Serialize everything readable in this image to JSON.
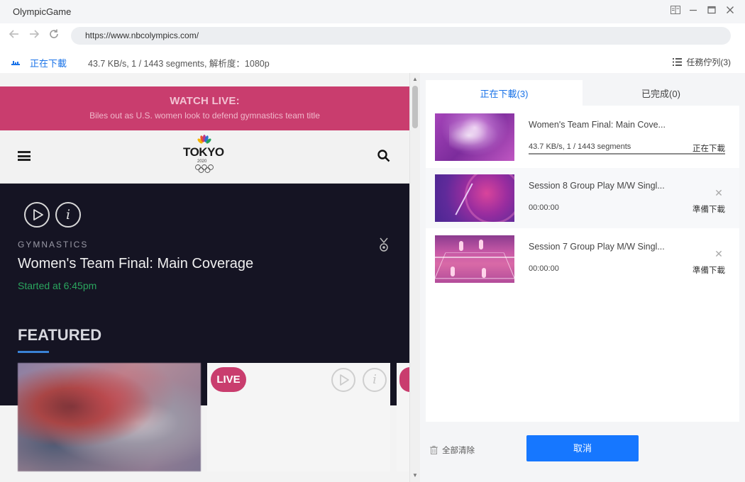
{
  "window": {
    "title": "OlympicGame",
    "controls": [
      "reader-icon",
      "minimize-icon",
      "maximize-icon",
      "close-icon"
    ]
  },
  "browser": {
    "url": "https://www.nbcolympics.com/"
  },
  "status": {
    "label": "正在下載",
    "info": "43.7 KB/s, 1 / 1443 segments, 解析度：1080p",
    "queue_label": "任務佇列(3)"
  },
  "website": {
    "banner_title": "WATCH LIVE:",
    "banner_subtitle": "Biles out as U.S. women look to defend gymnastics team title",
    "logo_text": "TOKYO",
    "logo_year": "2020",
    "hero": {
      "sport": "GYMNASTICS",
      "title": "Women's Team Final: Main Coverage",
      "time": "Started at 6:45pm"
    },
    "featured_label": "FEATURED",
    "live_badge": "LIVE",
    "info_glyph": "i",
    "colors": {
      "banner": "#c93d6e",
      "hero_bg": "#151423",
      "live_green": "#2aa55e"
    }
  },
  "panel": {
    "tabs": [
      {
        "label": "正在下載(3)",
        "active": true
      },
      {
        "label": "已完成(0)",
        "active": false
      }
    ],
    "tasks": [
      {
        "title": "Women's Team Final: Main Cove...",
        "info": "43.7 KB/s, 1 / 1443 segments",
        "status": "正在下載",
        "progress": 1.0
      },
      {
        "title": "Session 8 Group Play M/W Singl...",
        "info": "00:00:00",
        "status": "準備下載"
      },
      {
        "title": "Session 7 Group Play M/W Singl...",
        "info": "00:00:00",
        "status": "準備下載"
      }
    ],
    "clear_all": "全部清除",
    "cancel": "取消",
    "close_glyph": "✕",
    "colors": {
      "accent": "#1a73e8",
      "button": "#1677ff"
    }
  }
}
